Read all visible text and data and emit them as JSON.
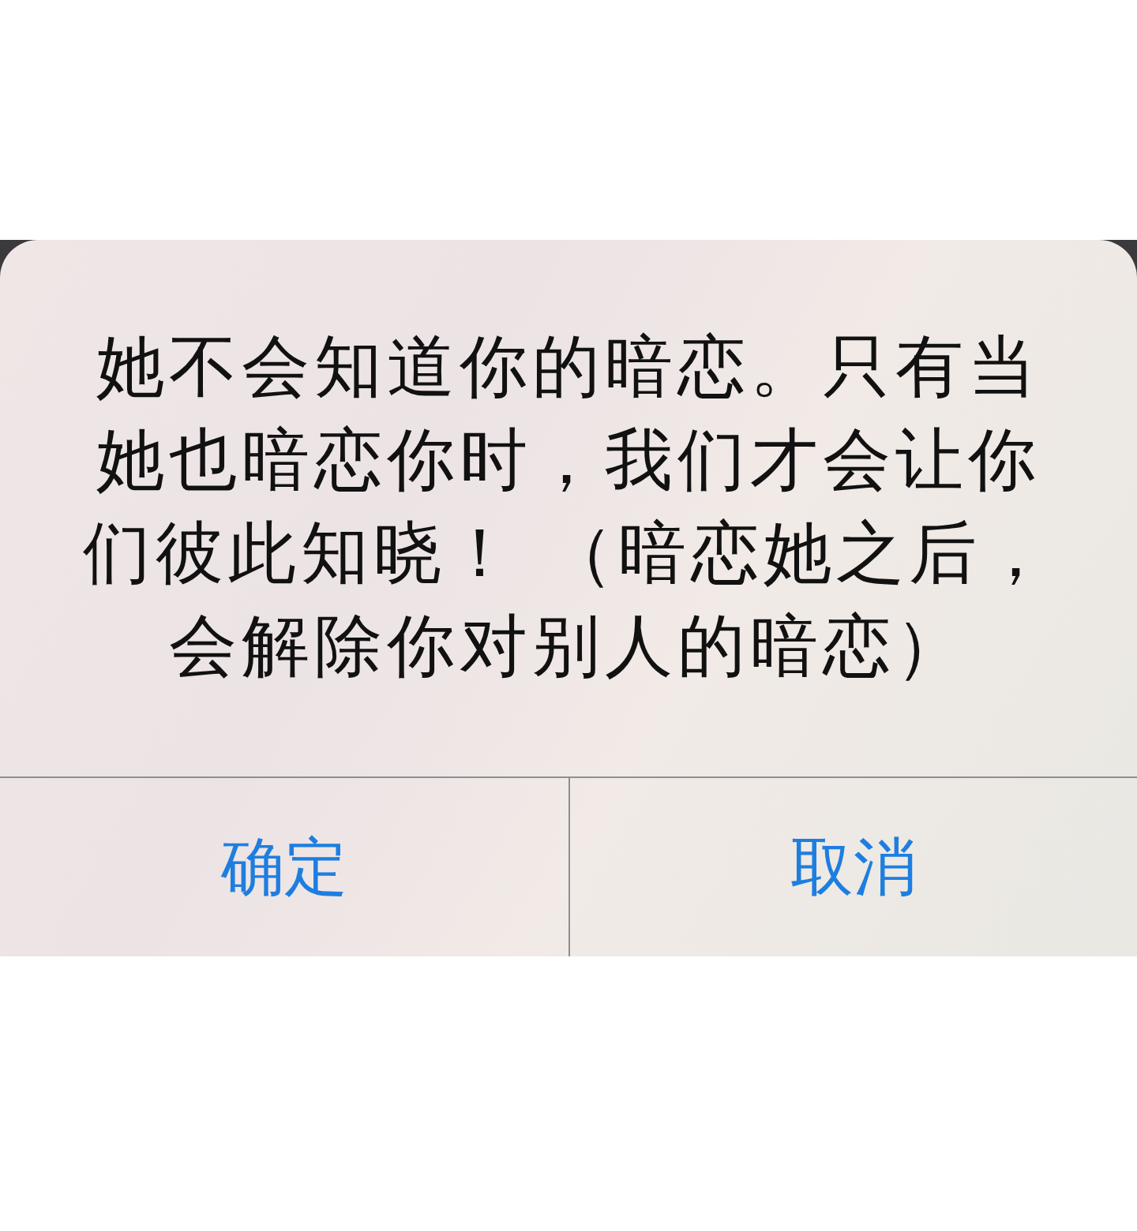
{
  "alert": {
    "message_lines": [
      "她不会知道你的暗恋。只有当",
      "她也暗恋你时，我们才会让你",
      "们彼此知晓！ （暗恋她之后，",
      "会解除你对别人的暗恋）"
    ],
    "buttons": [
      {
        "label": "确定"
      },
      {
        "label": "取消"
      }
    ]
  }
}
